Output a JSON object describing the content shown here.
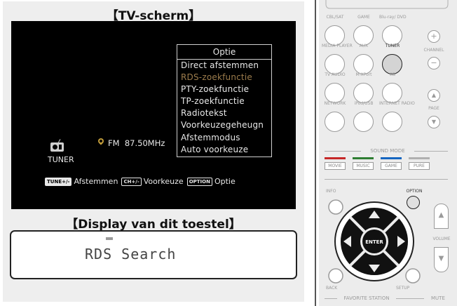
{
  "tv": {
    "heading": "【TV-scherm】",
    "menu": {
      "title": "Optie",
      "items": [
        {
          "label": "Direct afstemmen",
          "selected": false
        },
        {
          "label": "RDS-zoekfunctie",
          "selected": true
        },
        {
          "label": "PTY-zoekfunctie",
          "selected": false
        },
        {
          "label": "TP-zoekfunctie",
          "selected": false
        },
        {
          "label": "Radiotekst",
          "selected": false
        },
        {
          "label": "Voorkeuzegeheugn",
          "selected": false
        },
        {
          "label": "Afstemmodus",
          "selected": false
        },
        {
          "label": "Auto voorkeuze",
          "selected": false
        }
      ]
    },
    "source_label": "TUNER",
    "band": "FM",
    "frequency": "87.50MHz",
    "footer": {
      "tune_key": "TUNE+/-",
      "tune_text": "Afstemmen",
      "ch_key": "CH+/-",
      "ch_text": "Voorkeuze",
      "option_key": "OPTION",
      "option_text": "Optie"
    }
  },
  "display": {
    "heading": "【Display van dit toestel】",
    "text": "RDS Search"
  },
  "remote": {
    "source_rows": [
      [
        "CBL/SAT",
        "GAME",
        "Blu-ray/ DVD"
      ],
      [
        "MEDIA PLAYER",
        "AUX",
        "TUNER"
      ],
      [
        "TV AUDIO",
        "M-XPort",
        "CD"
      ],
      [
        "NETWORK",
        "iPod/USB",
        "INTERNET RADIO"
      ]
    ],
    "active_source": "TUNER",
    "channel_label": "CHANNEL",
    "page_label": "PAGE",
    "channel_up": "+",
    "channel_down": "−",
    "page_up": "▲",
    "page_down": "▼",
    "sound_mode_label": "SOUND MODE",
    "sound_modes": [
      "MOVIE",
      "MUSIC",
      "GAME",
      "PURE"
    ],
    "sound_mode_colors": [
      "#c62828",
      "#2e7d32",
      "#1565c0",
      "#b0b0b0"
    ],
    "info_label": "INFO",
    "option_label": "OPTION",
    "enter_label": "ENTER",
    "volume_label": "VOLUME",
    "volume_up": "▲",
    "volume_down": "▼",
    "back_label": "BACK",
    "setup_label": "SETUP",
    "favorite_label": "FAVORITE STATION",
    "mute_label": "MUTE"
  }
}
